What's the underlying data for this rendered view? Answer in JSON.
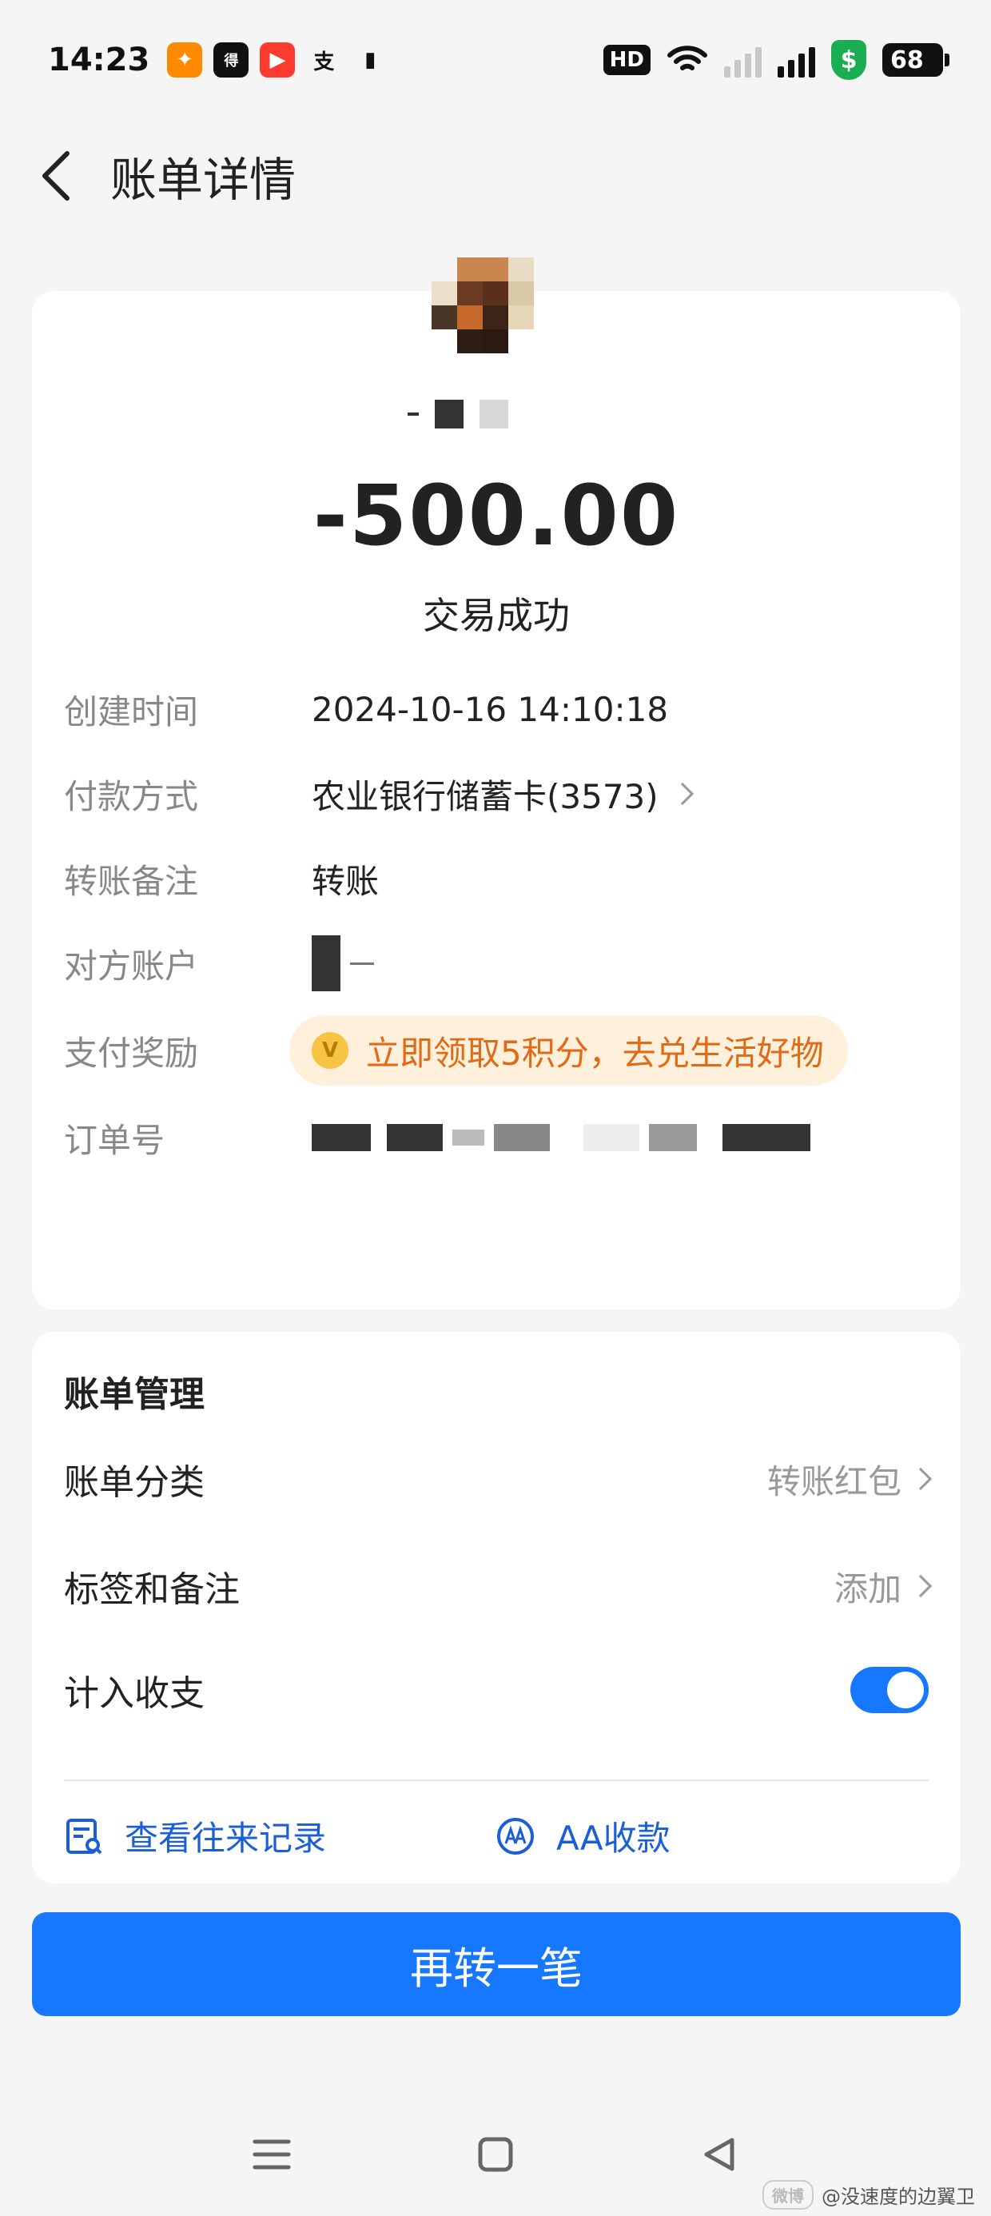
{
  "status_bar": {
    "time": "14:23",
    "apps": [
      "taobao-icon",
      "dewu-icon",
      "video-icon",
      "alipay-icon",
      "phone-icon"
    ],
    "hd_label": "HD",
    "shield_symbol": "$",
    "battery": "68"
  },
  "header": {
    "title": "账单详情"
  },
  "transaction": {
    "amount": "-500.00",
    "status": "交易成功",
    "rows": [
      {
        "label": "创建时间",
        "value": "2024-10-16 14:10:18"
      },
      {
        "label": "付款方式",
        "value": "农业银行储蓄卡(3573)"
      },
      {
        "label": "转账备注",
        "value": "转账"
      },
      {
        "label": "对方账户",
        "value": ""
      },
      {
        "label": "支付奖励",
        "value": "立即领取5积分，去兑生活好物"
      },
      {
        "label": "订单号",
        "value": ""
      }
    ]
  },
  "manage": {
    "title": "账单管理",
    "category_label": "账单分类",
    "category_value": "转账红包",
    "tags_label": "标签和备注",
    "tags_value": "添加",
    "include_label": "计入收支",
    "include_enabled": true,
    "history_label": "查看往来记录",
    "aa_label": "AA收款"
  },
  "primary_button": {
    "label": "再转一笔"
  },
  "watermark": {
    "logo": "微博",
    "text": "@没速度的边翼卫"
  },
  "colors": {
    "accent": "#1677ff",
    "reward": "#e06a16",
    "background": "#f5f5f5"
  }
}
